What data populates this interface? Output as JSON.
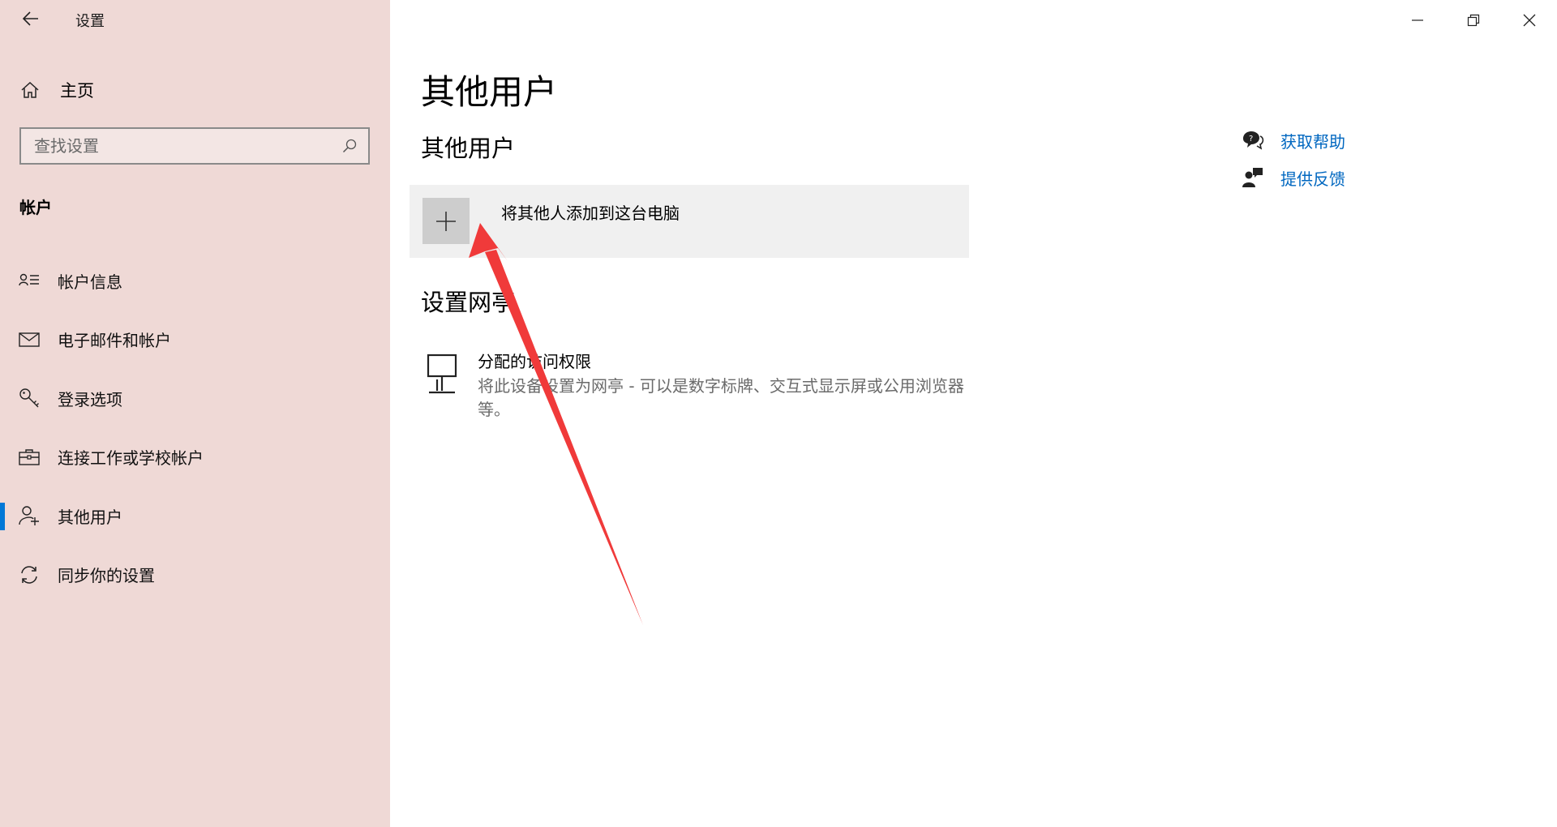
{
  "app": {
    "title": "设置"
  },
  "sidebar": {
    "home_label": "主页",
    "search": {
      "placeholder": "查找设置"
    },
    "section_label": "帐户",
    "items": [
      {
        "label": "帐户信息",
        "icon": "account-info-icon",
        "active": false
      },
      {
        "label": "电子邮件和帐户",
        "icon": "mail-icon",
        "active": false
      },
      {
        "label": "登录选项",
        "icon": "key-icon",
        "active": false
      },
      {
        "label": "连接工作或学校帐户",
        "icon": "briefcase-icon",
        "active": false
      },
      {
        "label": "其他用户",
        "icon": "add-person-icon",
        "active": true
      },
      {
        "label": "同步你的设置",
        "icon": "sync-icon",
        "active": false
      }
    ]
  },
  "main": {
    "page_title": "其他用户",
    "other_users": {
      "heading": "其他用户",
      "add_user_label": "将其他人添加到这台电脑"
    },
    "kiosk": {
      "heading": "设置网亭",
      "item_title": "分配的访问权限",
      "item_description": "将此设备设置为网亭 - 可以是数字标牌、交互式显示屏或公用浏览器等。"
    }
  },
  "help": {
    "get_help": "获取帮助",
    "give_feedback": "提供反馈"
  },
  "colors": {
    "sidebar_bg": "#efd9d6",
    "accent": "#0078d7",
    "link": "#0067c0",
    "annotation_arrow": "#f03a3a"
  }
}
